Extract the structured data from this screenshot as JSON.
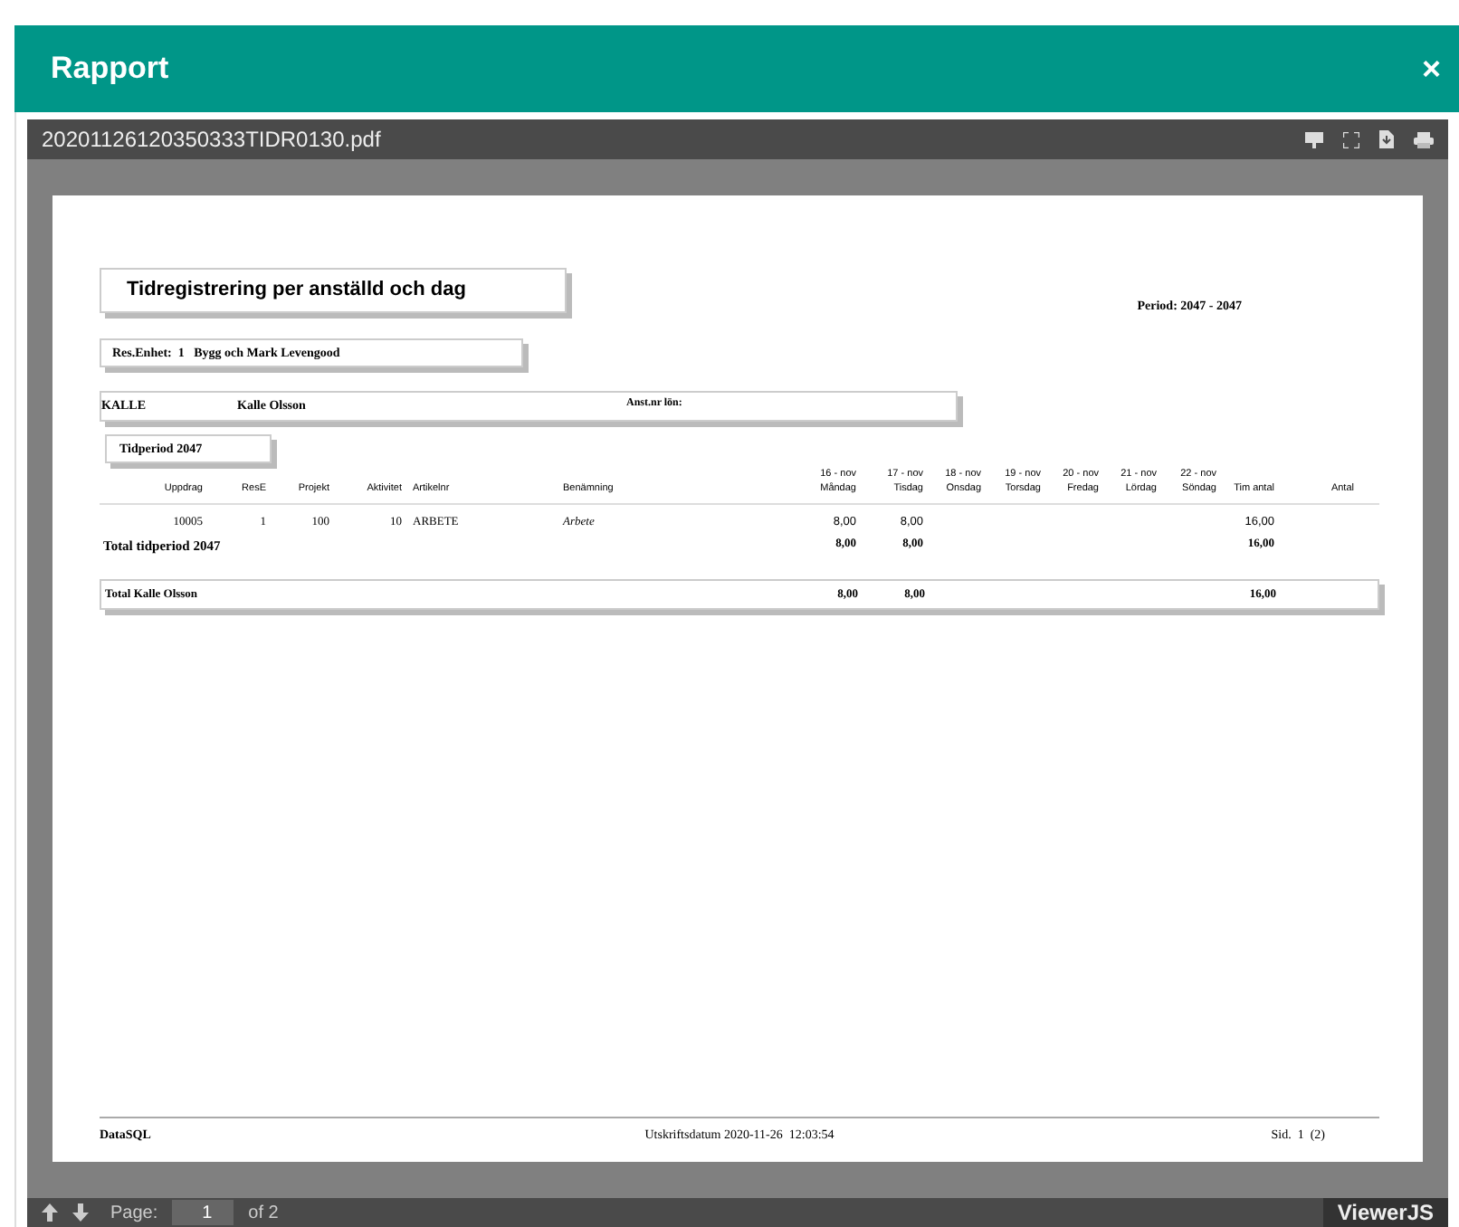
{
  "modal": {
    "title": "Rapport",
    "close": "×"
  },
  "viewer": {
    "filename": "20201126120350333TIDR0130.pdf",
    "page_label": "Page:",
    "page_value": "1",
    "page_total": "of 2",
    "brand": "ViewerJS"
  },
  "report": {
    "title": "Tidregistrering per anställd och dag",
    "period": "Period: 2047 - 2047",
    "unit": "Res.Enhet:  1   Bygg och Mark Levengood",
    "employee": {
      "id": "KALLE",
      "name": "Kalle Olsson",
      "salary_label": "Anst.nr lön:"
    },
    "period_box": "Tidperiod 2047",
    "columns": [
      {
        "label": "Uppdrag"
      },
      {
        "label": "ResE"
      },
      {
        "label": "Projekt"
      },
      {
        "label": "Aktivitet"
      },
      {
        "label": "Artikelnr"
      },
      {
        "label": "Benämning"
      },
      {
        "top": "16 - nov",
        "label": "Måndag"
      },
      {
        "top": "17 - nov",
        "label": "Tisdag"
      },
      {
        "top": "18 - nov",
        "label": "Onsdag"
      },
      {
        "top": "19 - nov",
        "label": "Torsdag"
      },
      {
        "top": "20 - nov",
        "label": "Fredag"
      },
      {
        "top": "21 - nov",
        "label": "Lördag"
      },
      {
        "top": "22 - nov",
        "label": "Söndag"
      },
      {
        "label": "Tim antal"
      },
      {
        "label": "Antal"
      }
    ],
    "rows": [
      {
        "kind": "line",
        "cells": [
          "10005",
          "1",
          "100",
          "10",
          "ARBETE",
          "Arbete",
          "8,00",
          "8,00",
          null,
          null,
          null,
          null,
          null,
          "16,00",
          null
        ]
      },
      {
        "kind": "subtotal",
        "label": "Total tidperiod 2047",
        "cells": [
          null,
          null,
          null,
          null,
          null,
          null,
          "8,00",
          "8,00",
          null,
          null,
          null,
          null,
          null,
          "16,00",
          null
        ]
      },
      {
        "kind": "total",
        "label": "Total  Kalle Olsson",
        "cells": [
          null,
          null,
          null,
          null,
          null,
          null,
          "8,00",
          "8,00",
          null,
          null,
          null,
          null,
          null,
          "16,00",
          null
        ]
      }
    ],
    "footer": {
      "left": "DataSQL",
      "center": "Utskriftsdatum 2020-11-26  12:03:54",
      "right": "Sid.  1  (2)"
    }
  }
}
